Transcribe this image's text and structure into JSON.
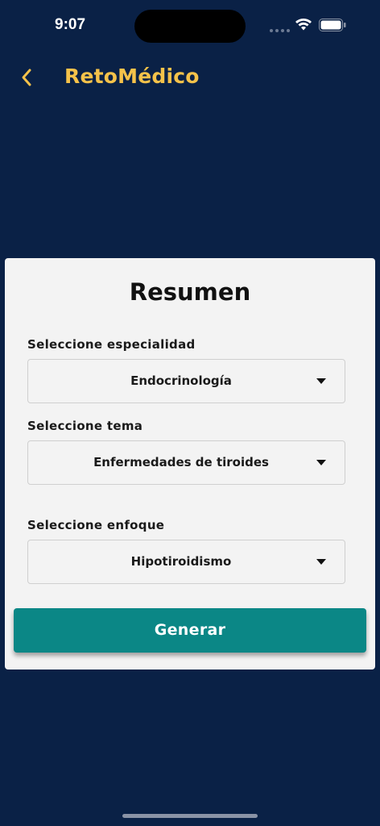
{
  "status_bar": {
    "time": "9:07"
  },
  "nav": {
    "back_icon": "chevron-left-icon",
    "title": "RetoMédico"
  },
  "card": {
    "title": "Resumen",
    "fields": [
      {
        "label": "Seleccione especialidad",
        "value": "Endocrinología"
      },
      {
        "label": "Seleccione tema",
        "value": "Enfermedades de tiroides"
      },
      {
        "label": "Seleccione enfoque",
        "value": "Hipotiroidismo"
      }
    ],
    "button_label": "Generar"
  },
  "colors": {
    "background": "#0a2146",
    "accent_title": "#f5c24a",
    "card": "#f3f3f3",
    "button": "#0b8786"
  }
}
